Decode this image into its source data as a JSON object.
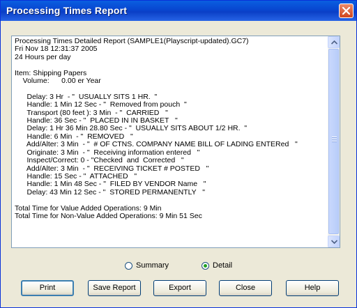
{
  "window": {
    "title": "Processing Times Report"
  },
  "report": {
    "lines": [
      "Processing Times Detailed Report (SAMPLE1(Playscript-updated).GC7)",
      "Fri Nov 18 12:31:37 2005",
      "24 Hours per day",
      "",
      "Item: Shipping Papers",
      "    Volume:      0.00 er Year",
      "",
      "      Delay: 3 Hr  - \"  USUALLY SITS 1 HR.  \"",
      "      Handle: 1 Min 12 Sec - \"  Removed from pouch  \"",
      "      Transport (80 feet ): 3 Min  - \"  CARRIED   \"",
      "      Handle: 36 Sec - \"  PLACED IN IN BASKET   \"",
      "      Delay: 1 Hr 36 Min 28.80 Sec - \"  USUALLY SITS ABOUT 1/2 HR.  \"",
      "      Handle: 6 Min  - \"  REMOVED   \"",
      "      Add/Alter: 3 Min  - \"  # OF CTNS. COMPANY NAME BILL OF LADING ENTERed   \"",
      "      Originate: 3 Min  - \"  Receiving information entered   \"",
      "      Inspect/Correct: 0 - \"Checked  and  Corrected   \"",
      "      Add/Alter: 3 Min  - \"  RECEIVING TICKET # POSTED   \"",
      "      Handle: 15 Sec - \"  ATTACHED   \"",
      "      Handle: 1 Min 48 Sec - \"  FILED BY VENDOR Name   \"",
      "      Delay: 43 Min 12 Sec - \"  STORED PERMANENTLY   \"",
      "",
      "Total Time for Value Added Operations: 9 Min",
      "Total Time for Non-Value Added Operations: 9 Min 51 Sec"
    ]
  },
  "view_options": {
    "summary_label": "Summary",
    "detail_label": "Detail",
    "selected": "Detail"
  },
  "buttons": {
    "print": "Print",
    "save_report": "Save Report",
    "export": "Export",
    "close": "Close",
    "help": "Help"
  },
  "icons": {
    "close": "close-icon",
    "scroll_up": "arrow-up-icon",
    "scroll_down": "arrow-down-icon"
  },
  "colors": {
    "titlebar": "#0a5fe0",
    "close_button": "#d0451d",
    "dialog_bg": "#ece9d8",
    "radio_selected": "#21a121"
  }
}
